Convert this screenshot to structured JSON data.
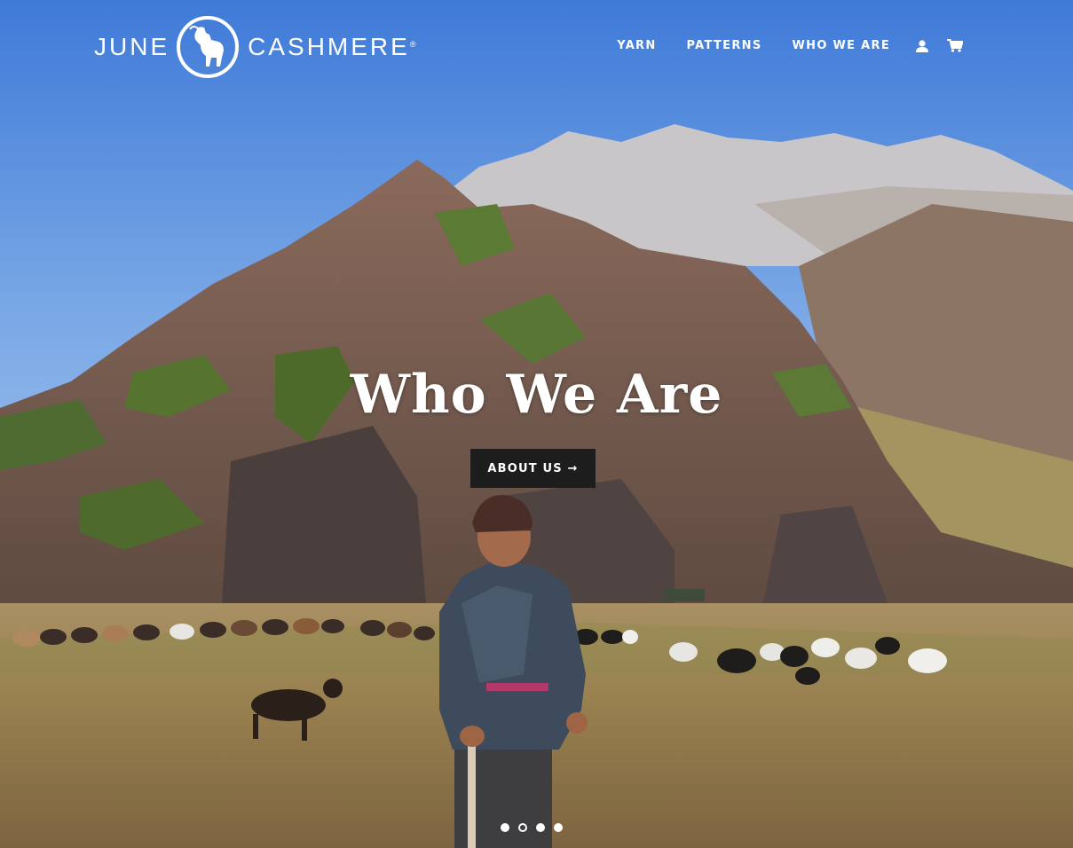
{
  "brand": {
    "name_left": "JUNE",
    "name_right": "CASHMERE",
    "trademark": "®"
  },
  "nav": {
    "items": [
      {
        "label": "YARN"
      },
      {
        "label": "PATTERNS"
      },
      {
        "label": "WHO WE ARE"
      }
    ],
    "account_icon": "user-icon",
    "cart_icon": "cart-icon"
  },
  "hero": {
    "title": "Who We Are",
    "cta_label": "ABOUT US →"
  },
  "slideshow": {
    "slide_count": 4,
    "active_slide": 2
  },
  "colors": {
    "sky": "#4f86da",
    "button_bg": "#1d1d1d",
    "text": "#ffffff"
  }
}
